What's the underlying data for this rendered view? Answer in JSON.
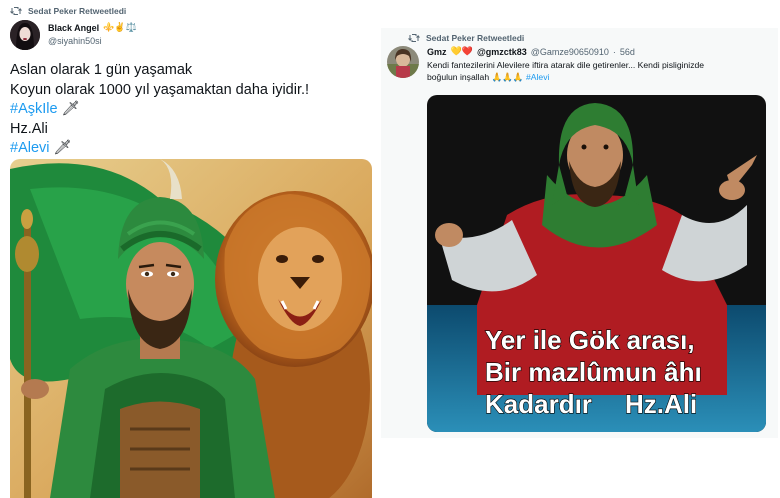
{
  "left_tweet": {
    "retweet_label": "Sedat Peker Retweetledi",
    "author_name": "Black Angel",
    "author_badges": "⚜️✌️⚖️",
    "author_handle": "@siyahin50si",
    "text_line1": "Aslan olarak 1 gün yaşamak",
    "text_line2": "Koyun olarak 1000 yıl yaşamaktan daha iyidir.!",
    "hashtag1": "#AşkIle",
    "hashtag1_emoji": "🗡",
    "text_line4": "Hz.Ali",
    "hashtag2": "#Alevi",
    "hashtag2_emoji": "🗡",
    "media_description": "Illustration of bearded man with green turban beside a roaring lion"
  },
  "right_tweet": {
    "retweet_label": "Sedat Peker Retweetledi",
    "author_name": "Gmz",
    "author_emojis": "💛❤️",
    "author_handle_display": "@gmzctk83",
    "author_handle_secondary": "@Gamze90650910",
    "time_sep": "·",
    "time": "56d",
    "text_line1": "Kendi fantezilerini Alevilere iftira atarak dile getirenler... Kendi pisliginizde",
    "text_line2": "boğulun inşallah",
    "text_line2_emojis": "🙏🙏🙏",
    "hashtag": "#Alevi",
    "media_caption_line1": "Yer ile Gök arası,",
    "media_caption_line2": "Bir mazlûmun âhı",
    "media_caption_line3_left": "Kadardır",
    "media_caption_line3_right": "Hz.Ali"
  },
  "colors": {
    "link": "#1d9bf0",
    "secondary_text": "#536471",
    "primary_text": "#0f1419"
  }
}
